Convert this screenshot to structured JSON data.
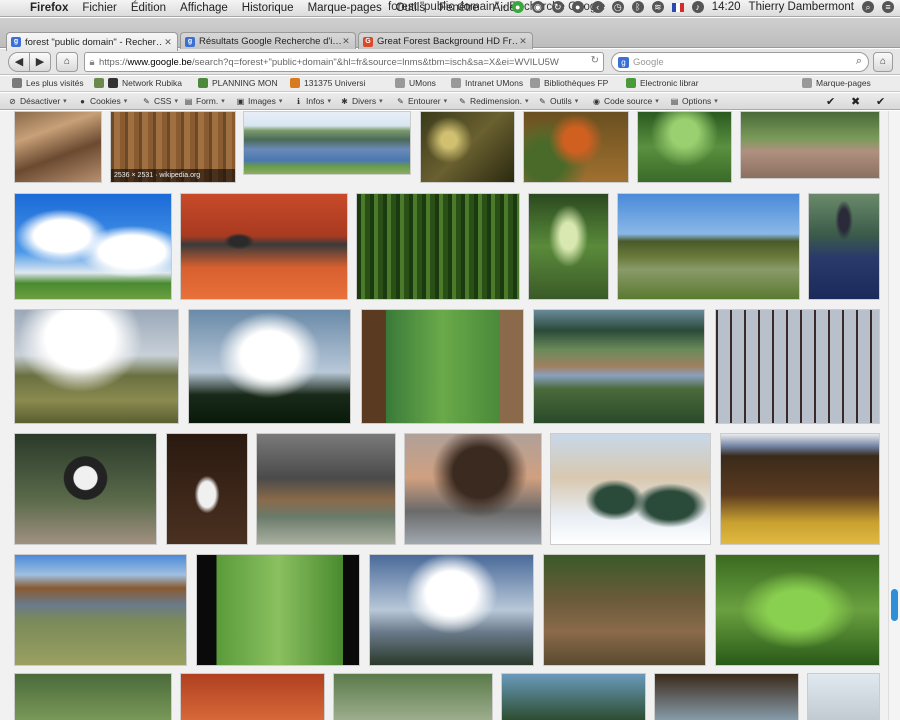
{
  "menubar": {
    "app_name": "Firefox",
    "menus": [
      "Fichier",
      "Édition",
      "Affichage",
      "Historique",
      "Marque-pages",
      "Outils",
      "Fenêtre",
      "Aide"
    ],
    "window_title": "forest \"public domain\" - Recherche Google",
    "clock": "14:20",
    "user": "Thierry Dambermont"
  },
  "tabs": [
    {
      "label": "forest \"public domain\" - Recher…",
      "favicon_color": "#3b6fd6",
      "favicon_letter": "g",
      "active": true
    },
    {
      "label": "Résultats Google Recherche d'i…",
      "favicon_color": "#3b6fd6",
      "favicon_letter": "g",
      "active": false
    },
    {
      "label": "Great Forest Background HD Fr…",
      "favicon_color": "#d84a2a",
      "favicon_letter": "G",
      "active": false
    }
  ],
  "newtab_label": "+",
  "navbar": {
    "back_label": "◀",
    "forward_label": "▶",
    "url_host": "www.google.be",
    "url_prefix": "https://",
    "url_rest": "/search?q=forest+\"public+domain\"&hl=fr&source=lnms&tbm=isch&sa=X&ei=WVILU5W",
    "url_reload": "↻",
    "search_placeholder": "Google",
    "search_engine_letter": "g"
  },
  "bookmarks": [
    {
      "label": "Les plus visités",
      "color": "#7a7a7a"
    },
    {
      "label": "",
      "color": "#6a8a4a"
    },
    {
      "label": "Network Rubika",
      "color": "#333"
    },
    {
      "label": "PLANNING MON",
      "color": "#4a8a3a"
    },
    {
      "label": "131375 Universi",
      "color": "#d87a20"
    },
    {
      "label": "UMons",
      "color": "#999"
    },
    {
      "label": "Intranet UMons",
      "color": "#999"
    },
    {
      "label": "Bibliothèques FP",
      "color": "#999"
    },
    {
      "label": "Electronic librar",
      "color": "#4a9a3a"
    },
    {
      "label": "Marque-pages",
      "color": "#999"
    }
  ],
  "devtoolbar": [
    {
      "label": "Désactiver",
      "icon": "⊘"
    },
    {
      "label": "Cookies",
      "icon": "●"
    },
    {
      "label": "CSS",
      "icon": "✎"
    },
    {
      "label": "Form.",
      "icon": "▤"
    },
    {
      "label": "Images",
      "icon": "▣"
    },
    {
      "label": "Infos",
      "icon": "ℹ"
    },
    {
      "label": "Divers",
      "icon": "✱"
    },
    {
      "label": "Entourer",
      "icon": "✎"
    },
    {
      "label": "Redimension.",
      "icon": "✎"
    },
    {
      "label": "Outils",
      "icon": "✎"
    },
    {
      "label": "Code source",
      "icon": "◉"
    },
    {
      "label": "Options",
      "icon": "▤"
    }
  ],
  "devtoolbar_status": [
    "✔",
    "✖",
    "✔"
  ],
  "image_results": [
    {
      "caption": ""
    },
    {
      "caption": "2536 × 2531 · wikipedia.org"
    }
  ],
  "colors": {
    "scrollbar_thumb": "#2e8fd8",
    "tab_active_bg": "#f0f0f0",
    "content_bg": "#f1f1f1"
  }
}
